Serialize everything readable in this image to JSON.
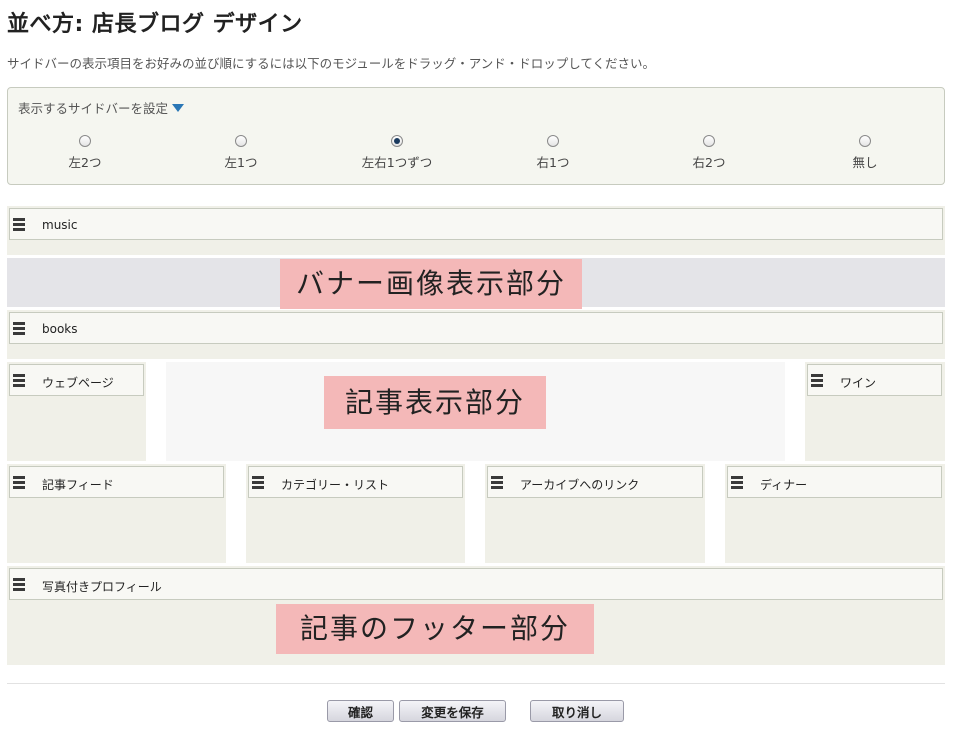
{
  "header": {
    "title": "並べ方: 店長ブログ デザイン",
    "description": "サイドバーの表示項目をお好みの並び順にするには以下のモジュールをドラッグ・アンド・ドロップしてください。"
  },
  "sidebar_setting": {
    "toggle_label": "表示するサイドバーを設定",
    "options": [
      {
        "label": "左2つ",
        "checked": false
      },
      {
        "label": "左1つ",
        "checked": false
      },
      {
        "label": "左右1つずつ",
        "checked": true
      },
      {
        "label": "右1つ",
        "checked": false
      },
      {
        "label": "右2つ",
        "checked": false
      },
      {
        "label": "無し",
        "checked": false
      }
    ]
  },
  "modules": {
    "music": "music",
    "books": "books",
    "webpage": "ウェブページ",
    "wine": "ワイン",
    "feed": "記事フィード",
    "category": "カテゴリー・リスト",
    "archive": "アーカイブへのリンク",
    "dinner": "ディナー",
    "profile": "写真付きプロフィール"
  },
  "overlays": {
    "banner": "バナー画像表示部分",
    "content": "記事表示部分",
    "footer": "記事のフッター部分"
  },
  "buttons": {
    "confirm": "確認",
    "save": "変更を保存",
    "cancel": "取り消し"
  },
  "colors": {
    "accent": "#2a77b6",
    "overlay": "#f4b8b8",
    "zone": "#f0f0e8"
  }
}
